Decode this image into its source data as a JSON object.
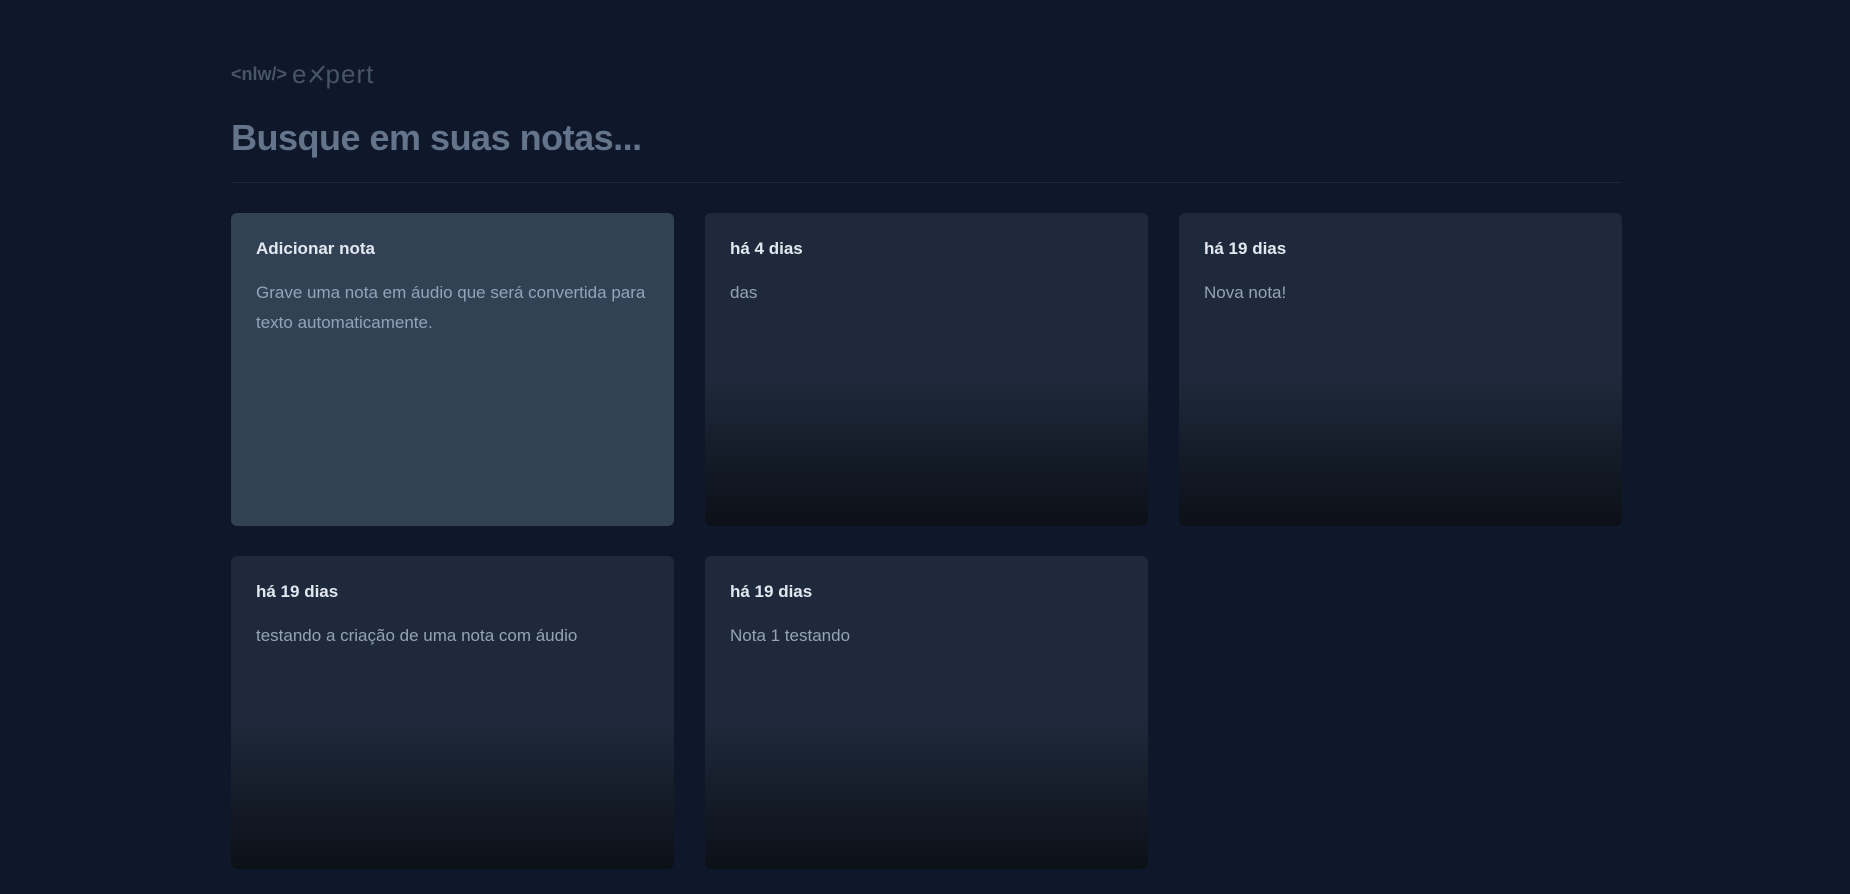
{
  "logo": {
    "tag": "<nlw/>",
    "word_start": "e",
    "word_end": "pert"
  },
  "search": {
    "placeholder": "Busque em suas notas..."
  },
  "add_card": {
    "title": "Adicionar nota",
    "body": "Grave uma nota em áudio que será convertida para texto automaticamente."
  },
  "notes": [
    {
      "date": "há 4 dias",
      "content": "das"
    },
    {
      "date": "há 19 dias",
      "content": "Nova nota!"
    },
    {
      "date": "há 19 dias",
      "content": "testando a criação de uma nota com áudio"
    },
    {
      "date": "há 19 dias",
      "content": "Nota 1 testando"
    }
  ],
  "colors": {
    "background": "#0f172a",
    "card": "#1e293b",
    "add_card": "#334155",
    "text_muted": "#94a3b8",
    "text_title": "#e2e8f0"
  }
}
